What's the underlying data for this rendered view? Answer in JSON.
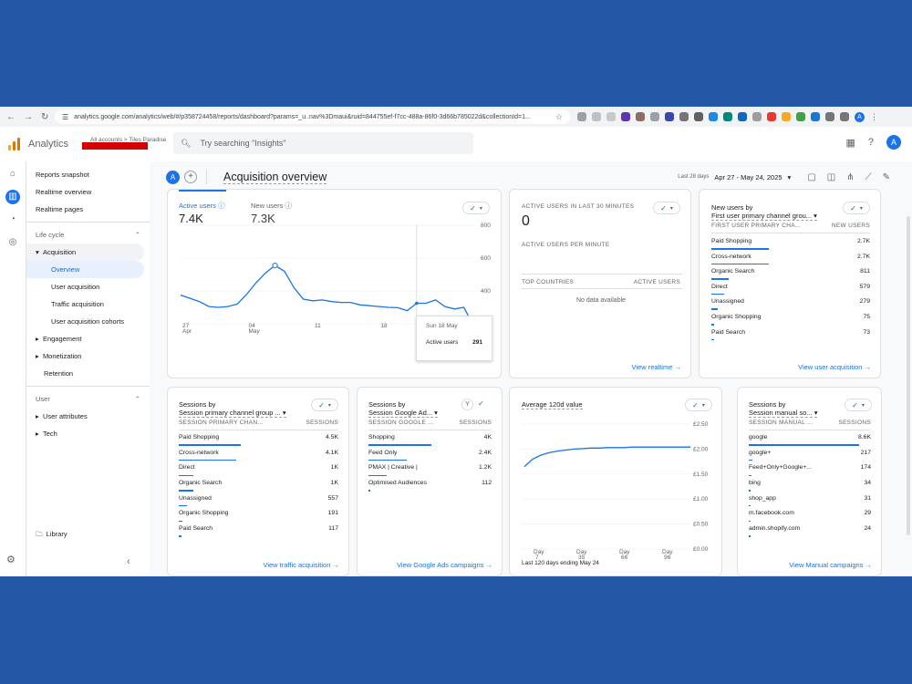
{
  "browser": {
    "url": "analytics.google.com/analytics/web/#/p358724458/reports/dashboard?params=_u..nav%3Dmaui&ruid=844755ef-f7cc-488a-86f0-3d66b785022d&collectionId=1..."
  },
  "app": {
    "name": "Analytics",
    "breadcrumb": "All accounts > Tiles Paradise",
    "search_placeholder": "Try searching \"Insights\"",
    "avatar": "A"
  },
  "nav": {
    "top": [
      "Reports snapshot",
      "Realtime overview",
      "Realtime pages"
    ],
    "lifecycle_label": "Life cycle",
    "acquisition": "Acquisition",
    "acquisition_items": [
      "Overview",
      "User acquisition",
      "Traffic acquisition",
      "User acquisition cohorts"
    ],
    "engagement": "Engagement",
    "monetization": "Monetization",
    "retention": "Retention",
    "user_label": "User",
    "user_items": [
      "User attributes",
      "Tech"
    ],
    "library": "Library"
  },
  "header": {
    "chip": "A",
    "title": "Acquisition overview",
    "date_label": "Last 28 days",
    "date_range": "Apr 27 - May 24, 2025"
  },
  "users_card": {
    "metric1_label": "Active users",
    "metric1_value": "7.4K",
    "metric2_label": "New users",
    "metric2_value": "7.3K",
    "tooltip_date": "Sun 18 May",
    "tooltip_label": "Active users",
    "tooltip_value": "291"
  },
  "chart_data": {
    "type": "line",
    "series": [
      {
        "values": [
          375,
          355,
          335,
          305,
          300,
          305,
          320,
          380,
          450,
          510,
          555,
          520,
          420,
          350,
          340,
          345,
          335,
          330,
          330,
          315,
          310,
          305,
          300,
          298,
          280,
          325,
          325,
          345,
          305,
          290,
          300,
          190
        ]
      }
    ],
    "ylim": [
      200,
      800
    ],
    "yticks": [
      "800",
      "600",
      "400",
      "200"
    ],
    "xticks": [
      {
        "label": "27",
        "sub": "Apr"
      },
      {
        "label": "04",
        "sub": "May"
      },
      {
        "label": "11",
        "sub": ""
      },
      {
        "label": "18",
        "sub": ""
      }
    ]
  },
  "realtime_card": {
    "title": "ACTIVE USERS IN LAST 30 MINUTES",
    "value": "0",
    "per_minute": "ACTIVE USERS PER MINUTE",
    "col1": "TOP COUNTRIES",
    "col2": "ACTIVE USERS",
    "empty": "No data available",
    "link": "View realtime"
  },
  "new_users_card": {
    "title": "New users by",
    "dimension": "First user primary channel grou...",
    "col1": "FIRST USER PRIMARY CHA...",
    "col2": "NEW USERS",
    "rows": [
      {
        "name": "Paid Shopping",
        "value": "2.7K",
        "share": 0.36
      },
      {
        "name": "Cross-network",
        "value": "2.7K",
        "share": 0.36
      },
      {
        "name": "Organic Search",
        "value": "811",
        "share": 0.11
      },
      {
        "name": "Direct",
        "value": "579",
        "share": 0.08
      },
      {
        "name": "Unassigned",
        "value": "279",
        "share": 0.04
      },
      {
        "name": "Organic Shopping",
        "value": "75",
        "share": 0.01
      },
      {
        "name": "Paid Search",
        "value": "73",
        "share": 0.01
      }
    ],
    "link": "View user acquisition"
  },
  "sessions_card": {
    "title": "Sessions by",
    "dimension": "Session primary channel group ...",
    "col1": "SESSION PRIMARY CHAN...",
    "col2": "SESSIONS",
    "rows": [
      {
        "name": "Paid Shopping",
        "value": "4.5K",
        "share": 0.39
      },
      {
        "name": "Cross-network",
        "value": "4.1K",
        "share": 0.36
      },
      {
        "name": "Direct",
        "value": "1K",
        "share": 0.09
      },
      {
        "name": "Organic Search",
        "value": "1K",
        "share": 0.09
      },
      {
        "name": "Unassigned",
        "value": "557",
        "share": 0.05
      },
      {
        "name": "Organic Shopping",
        "value": "191",
        "share": 0.02
      },
      {
        "name": "Paid Search",
        "value": "117",
        "share": 0.01
      }
    ],
    "link": "View traffic acquisition"
  },
  "ads_card": {
    "title": "Sessions by",
    "dimension": "Session Google Ad...",
    "col1": "SESSION GOOGLE ...",
    "col2": "SESSIONS",
    "rows": [
      {
        "name": "Shopping",
        "value": "4K",
        "share": 0.51
      },
      {
        "name": "Feed Only",
        "value": "2.4K",
        "share": 0.31
      },
      {
        "name": "PMAX | Creative |",
        "value": "1.2K",
        "share": 0.15
      },
      {
        "name": "Optimised Audiences",
        "value": "112",
        "share": 0.01
      }
    ],
    "link": "View Google Ads campaigns"
  },
  "value_card": {
    "title": "Average 120d value",
    "yticks": [
      "£2.50",
      "£2.00",
      "£1.50",
      "£1.00",
      "£0.50",
      "£0.00"
    ],
    "ylim": [
      0,
      2.5
    ],
    "values": [
      1.65,
      1.8,
      1.88,
      1.93,
      1.96,
      1.98,
      2.0,
      2.01,
      2.02,
      2.02,
      2.03,
      2.03,
      2.03,
      2.04,
      2.04,
      2.04,
      2.04,
      2.04,
      2.04,
      2.04,
      2.04
    ],
    "xticks": [
      {
        "label": "Day",
        "sub": "7"
      },
      {
        "label": "Day",
        "sub": "35"
      },
      {
        "label": "Day",
        "sub": "66"
      },
      {
        "label": "Day",
        "sub": "96"
      }
    ],
    "footer": "Last 120 days ending May 24"
  },
  "manual_card": {
    "title": "Sessions by",
    "dimension": "Session manual so...",
    "col1": "SESSION MANUAL ...",
    "col2": "SESSIONS",
    "rows": [
      {
        "name": "google",
        "value": "8.6K",
        "share": 0.9
      },
      {
        "name": "google+",
        "value": "217",
        "share": 0.03
      },
      {
        "name": "Feed+Only+Google+...",
        "value": "174",
        "share": 0.02
      },
      {
        "name": "bing",
        "value": "34",
        "share": 0.005
      },
      {
        "name": "shop_app",
        "value": "31",
        "share": 0.004
      },
      {
        "name": "m.facebook.com",
        "value": "29",
        "share": 0.004
      },
      {
        "name": "admin.shopify.com",
        "value": "24",
        "share": 0.003
      }
    ],
    "link": "View Manual campaigns"
  },
  "colors": {
    "accent": "#1a73e8",
    "check": "#188038",
    "background": "#2457a6"
  }
}
